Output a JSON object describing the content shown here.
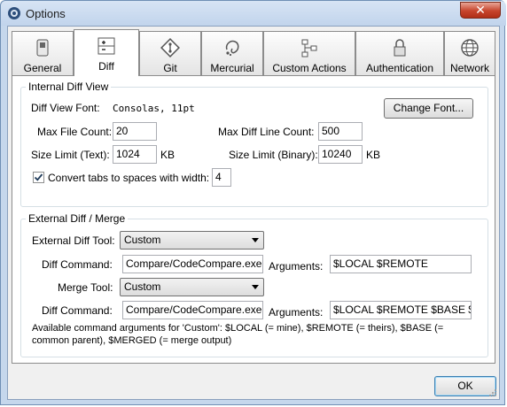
{
  "window": {
    "title": "Options",
    "close_glyph": "✕"
  },
  "tabs": [
    {
      "label": "General",
      "icon": "switch-icon",
      "active": false
    },
    {
      "label": "Diff",
      "icon": "diff-icon",
      "active": true
    },
    {
      "label": "Git",
      "icon": "git-icon",
      "active": false
    },
    {
      "label": "Mercurial",
      "icon": "mercurial-icon",
      "active": false
    },
    {
      "label": "Custom Actions",
      "icon": "custom-actions-icon",
      "active": false
    },
    {
      "label": "Authentication",
      "icon": "lock-icon",
      "active": false
    },
    {
      "label": "Network",
      "icon": "globe-icon",
      "active": false
    }
  ],
  "internal": {
    "legend": "Internal Diff View",
    "font_label": "Diff View Font:",
    "font_value": "Consolas, 11pt",
    "change_font": "Change Font...",
    "max_file_count_label": "Max File Count:",
    "max_file_count": "20",
    "max_line_count_label": "Max Diff Line Count:",
    "max_line_count": "500",
    "size_text_label": "Size Limit (Text):",
    "size_text": "1024",
    "size_text_unit": "KB",
    "size_binary_label": "Size Limit (Binary):",
    "size_binary": "10240",
    "size_binary_unit": "KB",
    "tabs_checkbox_label": "Convert tabs to spaces with width:",
    "tabs_checked": true,
    "tab_width": "4"
  },
  "external": {
    "legend": "External Diff / Merge",
    "diff_tool_label": "External Diff Tool:",
    "diff_tool": "Custom",
    "diff_command_label": "Diff Command:",
    "diff_command": "Compare/CodeCompare.exe",
    "arguments_label": "Arguments:",
    "diff_arguments": "$LOCAL $REMOTE",
    "merge_tool_label": "Merge Tool:",
    "merge_tool": "Custom",
    "merge_command_label": "Diff Command:",
    "merge_command": "Compare/CodeCompare.exe",
    "merge_arguments_label": "Arguments:",
    "merge_arguments": "$LOCAL $REMOTE $BASE $M",
    "help_line1": "Available command arguments for 'Custom': $LOCAL (= mine), $REMOTE (= theirs), $BASE (=",
    "help_line2": "common parent), $MERGED (= merge output)"
  },
  "footer": {
    "ok_label": "OK"
  }
}
